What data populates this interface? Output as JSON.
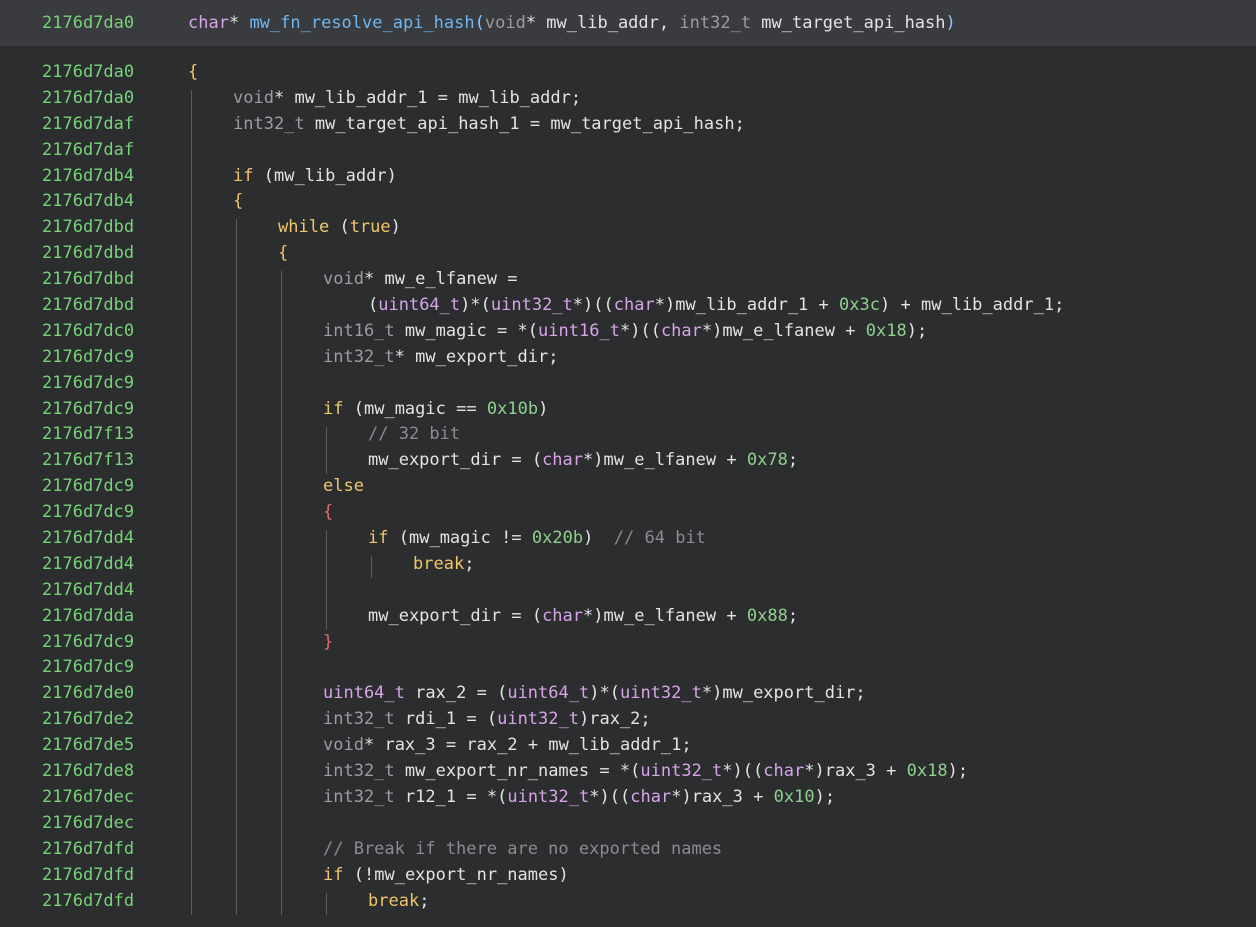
{
  "header": {
    "address": "2176d7da0",
    "return_type": "char",
    "function_name": "mw_fn_resolve_api_hash",
    "param1_type": "void",
    "param1_name": "mw_lib_addr",
    "param2_type": "int32_t",
    "param2_name": "mw_target_api_hash"
  },
  "lines": [
    {
      "addr": "2176d7da0",
      "indent": 0,
      "code": "{"
    },
    {
      "addr": "2176d7da0",
      "indent": 1,
      "code": "void* mw_lib_addr_1 = mw_lib_addr;"
    },
    {
      "addr": "2176d7daf",
      "indent": 1,
      "code": "int32_t mw_target_api_hash_1 = mw_target_api_hash;"
    },
    {
      "addr": "2176d7daf",
      "indent": 1,
      "code": ""
    },
    {
      "addr": "2176d7db4",
      "indent": 1,
      "code": "if (mw_lib_addr)"
    },
    {
      "addr": "2176d7db4",
      "indent": 1,
      "code": "{"
    },
    {
      "addr": "2176d7dbd",
      "indent": 2,
      "code": "while (true)"
    },
    {
      "addr": "2176d7dbd",
      "indent": 2,
      "code": "{"
    },
    {
      "addr": "2176d7dbd",
      "indent": 3,
      "code": "void* mw_e_lfanew ="
    },
    {
      "addr": "2176d7dbd",
      "indent": 4,
      "code": "(uint64_t)*(uint32_t*)((char*)mw_lib_addr_1 + 0x3c) + mw_lib_addr_1;"
    },
    {
      "addr": "2176d7dc0",
      "indent": 3,
      "code": "int16_t mw_magic = *(uint16_t*)((char*)mw_e_lfanew + 0x18);"
    },
    {
      "addr": "2176d7dc9",
      "indent": 3,
      "code": "int32_t* mw_export_dir;"
    },
    {
      "addr": "2176d7dc9",
      "indent": 3,
      "code": ""
    },
    {
      "addr": "2176d7dc9",
      "indent": 3,
      "code": "if (mw_magic == 0x10b)"
    },
    {
      "addr": "2176d7f13",
      "indent": 4,
      "code": "// 32 bit"
    },
    {
      "addr": "2176d7f13",
      "indent": 4,
      "code": "mw_export_dir = (char*)mw_e_lfanew + 0x78;"
    },
    {
      "addr": "2176d7dc9",
      "indent": 3,
      "code": "else"
    },
    {
      "addr": "2176d7dc9",
      "indent": 3,
      "code": "{"
    },
    {
      "addr": "2176d7dd4",
      "indent": 4,
      "code": "if (mw_magic != 0x20b)  // 64 bit"
    },
    {
      "addr": "2176d7dd4",
      "indent": 5,
      "code": "break;"
    },
    {
      "addr": "2176d7dd4",
      "indent": 4,
      "code": ""
    },
    {
      "addr": "2176d7dda",
      "indent": 4,
      "code": "mw_export_dir = (char*)mw_e_lfanew + 0x88;"
    },
    {
      "addr": "2176d7dc9",
      "indent": 3,
      "code": "}"
    },
    {
      "addr": "2176d7dc9",
      "indent": 3,
      "code": ""
    },
    {
      "addr": "2176d7de0",
      "indent": 3,
      "code": "uint64_t rax_2 = (uint64_t)*(uint32_t*)mw_export_dir;"
    },
    {
      "addr": "2176d7de2",
      "indent": 3,
      "code": "int32_t rdi_1 = (uint32_t)rax_2;"
    },
    {
      "addr": "2176d7de5",
      "indent": 3,
      "code": "void* rax_3 = rax_2 + mw_lib_addr_1;"
    },
    {
      "addr": "2176d7de8",
      "indent": 3,
      "code": "int32_t mw_export_nr_names = *(uint32_t*)((char*)rax_3 + 0x18);"
    },
    {
      "addr": "2176d7dec",
      "indent": 3,
      "code": "int32_t r12_1 = *(uint32_t*)((char*)rax_3 + 0x10);"
    },
    {
      "addr": "2176d7dec",
      "indent": 3,
      "code": ""
    },
    {
      "addr": "2176d7dfd",
      "indent": 3,
      "code": "// Break if there are no exported names"
    },
    {
      "addr": "2176d7dfd",
      "indent": 3,
      "code": "if (!mw_export_nr_names)"
    },
    {
      "addr": "2176d7dfd",
      "indent": 4,
      "code": "break;"
    }
  ],
  "colors": {
    "background": "#2b2d2f",
    "header_background": "#393b3e",
    "address": "#79d27a",
    "keyword": "#f0c66b",
    "type": "#d7a4e8",
    "number": "#8fd08f",
    "function": "#6fb6f0",
    "comment": "#8a8c90"
  }
}
